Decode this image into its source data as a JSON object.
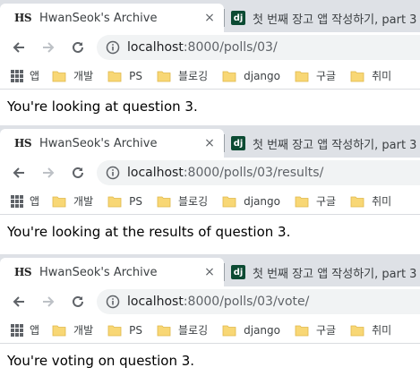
{
  "windows": [
    {
      "active_tab": {
        "favicon": "HS",
        "title": "HwanSeok's Archive",
        "close": "×"
      },
      "inactive_tab": {
        "favicon": "dj",
        "title": "첫 번째 장고 앱 작성하기, part 3"
      },
      "url": {
        "host": "localhost",
        "path": ":8000/polls/03/"
      },
      "content": "You're looking at question 3."
    },
    {
      "active_tab": {
        "favicon": "HS",
        "title": "HwanSeok's Archive",
        "close": "×"
      },
      "inactive_tab": {
        "favicon": "dj",
        "title": "첫 번째 장고 앱 작성하기, part 3"
      },
      "url": {
        "host": "localhost",
        "path": ":8000/polls/03/results/"
      },
      "content": "You're looking at the results of question 3."
    },
    {
      "active_tab": {
        "favicon": "HS",
        "title": "HwanSeok's Archive",
        "close": "×"
      },
      "inactive_tab": {
        "favicon": "dj",
        "title": "첫 번째 장고 앱 작성하기, part 3"
      },
      "url": {
        "host": "localhost",
        "path": ":8000/polls/03/vote/"
      },
      "content": "You're voting on question 3."
    }
  ],
  "bookmarks": {
    "apps_label": "앱",
    "folders": [
      "개발",
      "PS",
      "블로깅",
      "django",
      "구글",
      "취미"
    ]
  },
  "colors": {
    "tabbar_bg": "#dee1e6",
    "omnibox_bg": "#f1f3f4",
    "folder": "#f8d775",
    "django_green": "#0c4b33"
  },
  "icons": [
    "back-arrow-icon",
    "forward-arrow-icon",
    "reload-icon",
    "info-icon",
    "apps-grid-icon",
    "folder-icon",
    "close-icon"
  ]
}
